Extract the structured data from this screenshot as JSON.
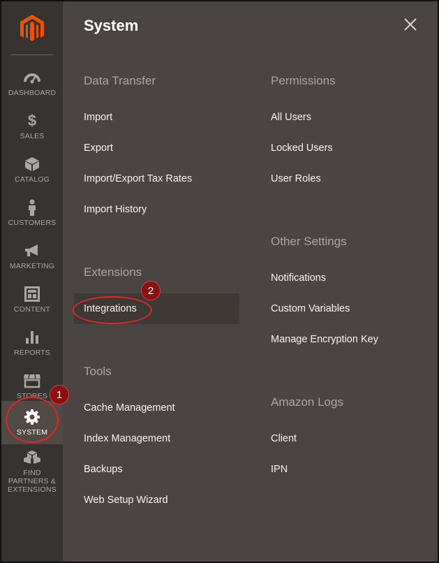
{
  "sidebar": {
    "items": [
      {
        "label": "DASHBOARD",
        "icon": "dashboard-gauge-icon"
      },
      {
        "label": "SALES",
        "icon": "dollar-icon"
      },
      {
        "label": "CATALOG",
        "icon": "box-icon"
      },
      {
        "label": "CUSTOMERS",
        "icon": "person-icon"
      },
      {
        "label": "MARKETING",
        "icon": "megaphone-icon"
      },
      {
        "label": "CONTENT",
        "icon": "layout-icon"
      },
      {
        "label": "REPORTS",
        "icon": "bar-chart-icon"
      },
      {
        "label": "STORES",
        "icon": "storefront-icon"
      },
      {
        "label": "SYSTEM",
        "icon": "gear-icon",
        "active": true
      },
      {
        "label": "FIND PARTNERS & EXTENSIONS",
        "icon": "cubes-icon"
      }
    ]
  },
  "panel": {
    "title": "System",
    "close_icon": "close-icon",
    "left_column": {
      "data_transfer": {
        "title": "Data Transfer",
        "links": [
          "Import",
          "Export",
          "Import/Export Tax Rates",
          "Import History"
        ]
      },
      "extensions": {
        "title": "Extensions",
        "links": [
          "Integrations"
        ]
      },
      "tools": {
        "title": "Tools",
        "links": [
          "Cache Management",
          "Index Management",
          "Backups",
          "Web Setup Wizard"
        ]
      }
    },
    "right_column": {
      "permissions": {
        "title": "Permissions",
        "links": [
          "All Users",
          "Locked Users",
          "User Roles"
        ]
      },
      "other_settings": {
        "title": "Other Settings",
        "links": [
          "Notifications",
          "Custom Variables",
          "Manage Encryption Key"
        ]
      },
      "amazon_logs": {
        "title": "Amazon Logs",
        "links": [
          "Client",
          "IPN"
        ]
      }
    }
  },
  "annotations": {
    "step1": "1",
    "step2": "2"
  },
  "colors": {
    "sidebar_bg": "#373330",
    "panel_bg": "#4a4542",
    "active_item_bg": "#514943",
    "brand_orange": "#eb5202",
    "annotation_red": "#e22626"
  }
}
